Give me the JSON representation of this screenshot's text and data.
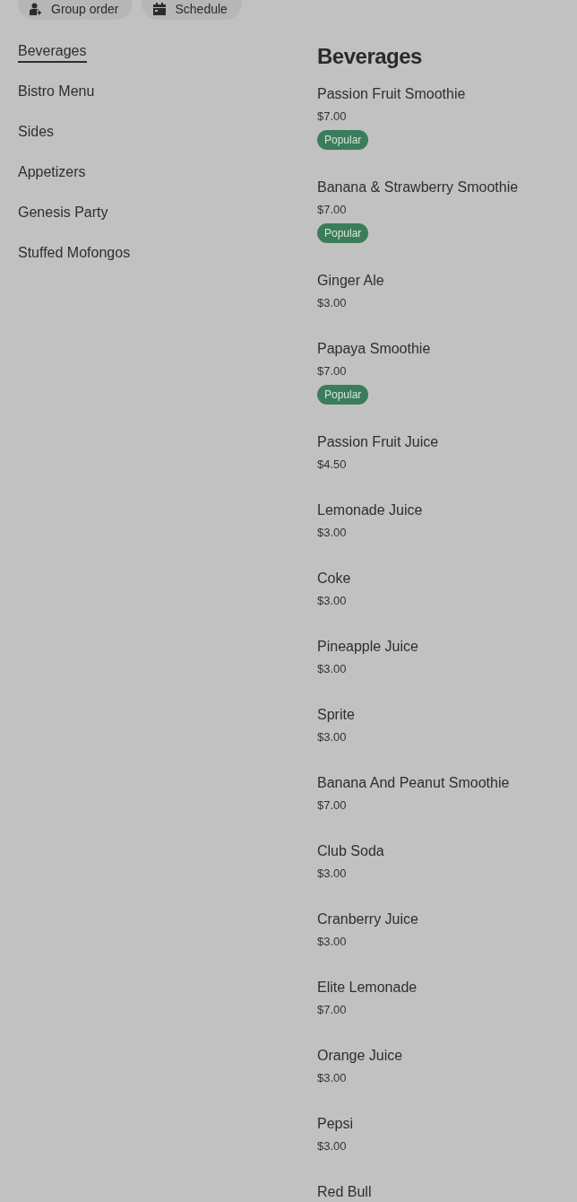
{
  "toolbar": {
    "buttons": [
      {
        "label": "Group order",
        "kind": "group"
      },
      {
        "label": "Schedule",
        "kind": "schedule"
      }
    ]
  },
  "sidebar": {
    "items": [
      {
        "label": "Beverages",
        "selected": true
      },
      {
        "label": "Bistro Menu",
        "selected": false
      },
      {
        "label": "Sides",
        "selected": false
      },
      {
        "label": "Appetizers",
        "selected": false
      },
      {
        "label": "Genesis Party",
        "selected": false
      },
      {
        "label": "Stuffed Mofongos",
        "selected": false
      }
    ]
  },
  "section": {
    "title": "Beverages",
    "items": [
      {
        "name": "Passion Fruit Smoothie",
        "price": "$7.00",
        "badge": "Popular"
      },
      {
        "name": "Banana & Strawberry Smoothie",
        "price": "$7.00",
        "badge": "Popular"
      },
      {
        "name": "Ginger Ale",
        "price": "$3.00"
      },
      {
        "name": "Papaya Smoothie",
        "price": "$7.00",
        "badge": "Popular"
      },
      {
        "name": "Passion Fruit Juice",
        "price": "$4.50"
      },
      {
        "name": "Lemonade Juice",
        "price": "$3.00"
      },
      {
        "name": "Coke",
        "price": "$3.00"
      },
      {
        "name": "Pineapple Juice",
        "price": "$3.00"
      },
      {
        "name": "Sprite",
        "price": "$3.00"
      },
      {
        "name": "Banana And Peanut Smoothie",
        "price": "$7.00"
      },
      {
        "name": "Club Soda",
        "price": "$3.00"
      },
      {
        "name": "Cranberry Juice",
        "price": "$3.00"
      },
      {
        "name": "Elite Lemonade",
        "price": "$7.00"
      },
      {
        "name": "Orange Juice",
        "price": "$3.00"
      },
      {
        "name": "Pepsi",
        "price": "$3.00"
      },
      {
        "name": "Red Bull"
      }
    ]
  }
}
